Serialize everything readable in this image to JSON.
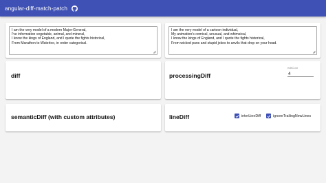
{
  "toolbar": {
    "title": "angular-diff-match-patch",
    "icon": "github-icon"
  },
  "inputs": {
    "left": "I am the very model of a modern Major-General,\nI've information vegetable, animal, and mineral,\nI know the kings of England, and I quote the fights historical,\nFrom Marathon to Waterloo, in order categorical.",
    "right": "I am the very model of a cartoon individual,\nMy animation's comical, unusual, and whimsical,\nI know the kings of England, and I quote the fights historical,\nFrom wicked puns and stupid jokes to anvils that drop on your head."
  },
  "cards": {
    "diff": {
      "title": "diff"
    },
    "processing": {
      "title": "processingDiff",
      "edit_cost_label": "editCost",
      "edit_cost_value": "4"
    },
    "semantic": {
      "title": "semanticDiff (with custom attributes)"
    },
    "line": {
      "title": "lineDiff",
      "option1_label": "interLineDiff",
      "option1_checked": true,
      "option2_label": "ignoreTrailingNewLines",
      "option2_checked": true
    }
  },
  "colors": {
    "toolbar": "#3f51b5",
    "checkbox": "#3f51b5",
    "background": "#f3f3f3"
  }
}
